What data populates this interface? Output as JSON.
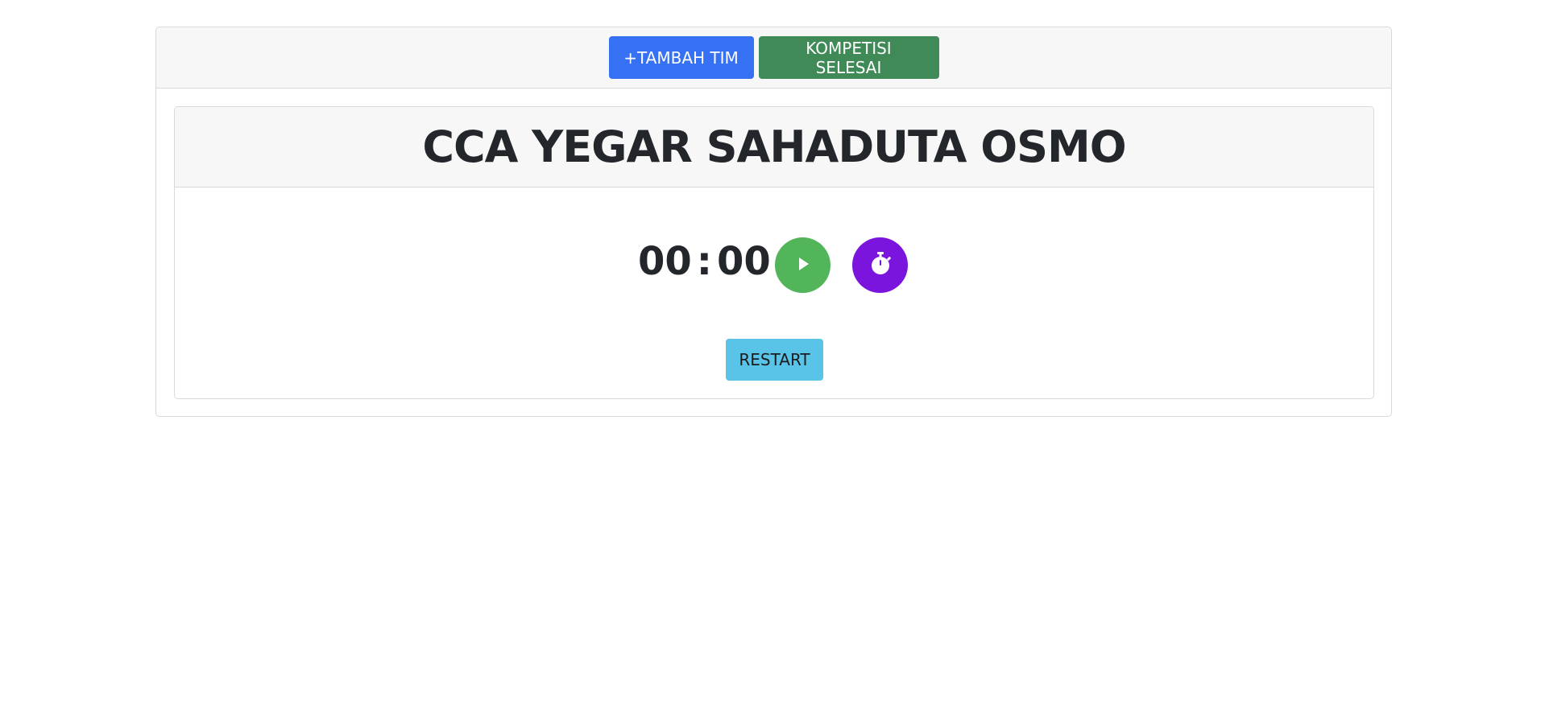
{
  "toolbar": {
    "add_team_label": "+TAMBAH TIM",
    "finish_label": "KOMPETISI SELESAI"
  },
  "team": {
    "name": "CCA YEGAR SAHADUTA OSMO"
  },
  "timer": {
    "minutes": "00",
    "separator": ":",
    "seconds": "00"
  },
  "controls": {
    "play_icon": "play-icon",
    "stopwatch_icon": "stopwatch-icon",
    "restart_label": "RESTART"
  },
  "colors": {
    "primary": "#3671f4",
    "success": "#408a58",
    "play": "#52b55a",
    "stopwatch": "#7b14dd",
    "restart": "#5ac3e8"
  }
}
